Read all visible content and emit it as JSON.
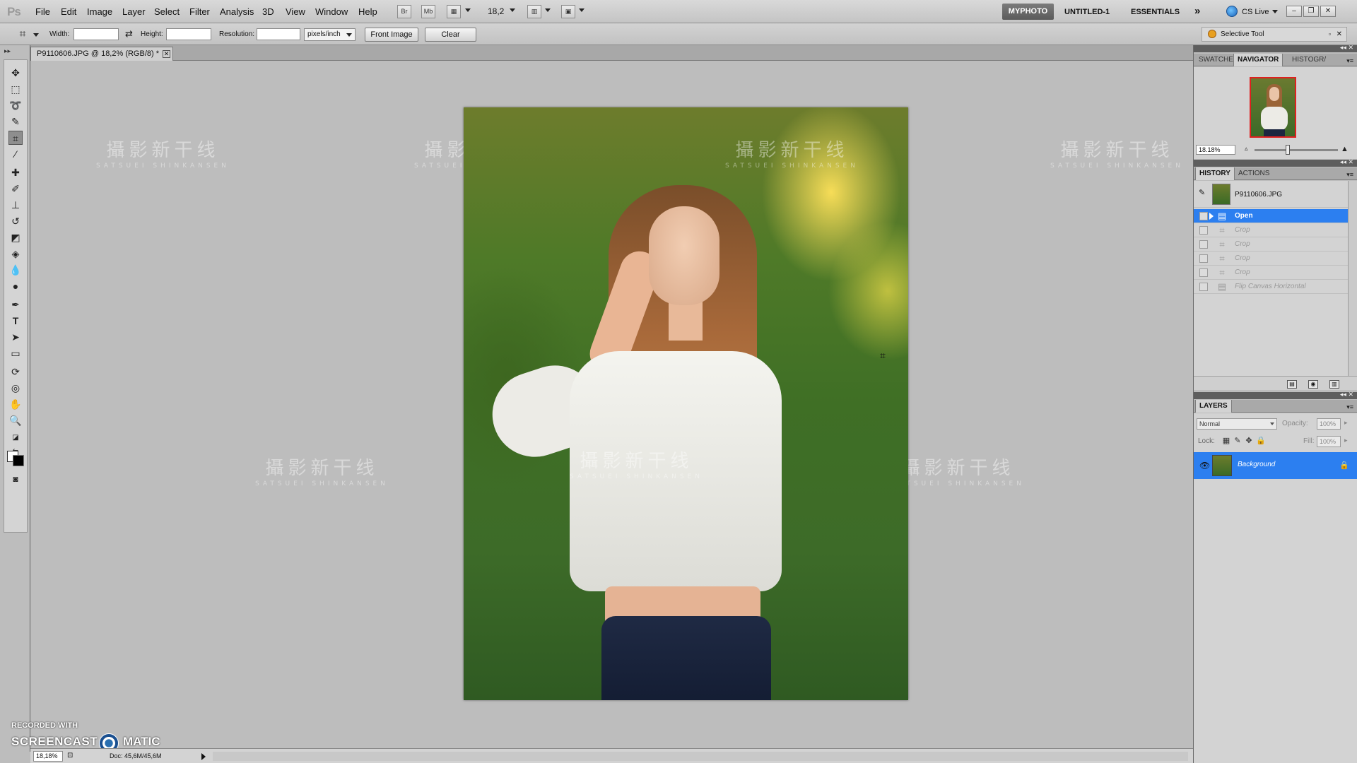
{
  "app": {
    "logo": "Ps",
    "menu": [
      "File",
      "Edit",
      "Image",
      "Layer",
      "Select",
      "Filter",
      "Analysis",
      "3D",
      "View",
      "Window",
      "Help"
    ],
    "bridge_button": "Br",
    "minibridge_button": "Mb",
    "zoom_level": "18,2",
    "workspaces": {
      "active": "MYPHOTO",
      "others": [
        "UNTITLED-1",
        "ESSENTIALS"
      ],
      "more": "»"
    },
    "cs_live": "CS Live",
    "window_controls": {
      "minimize": "–",
      "restore": "❐",
      "close": "✕"
    }
  },
  "options": {
    "width_label": "Width:",
    "width_value": "",
    "swap_icon": "⇄",
    "height_label": "Height:",
    "height_value": "",
    "resolution_label": "Resolution:",
    "resolution_value": "",
    "unit": "pixels/inch",
    "front_image": "Front Image",
    "clear": "Clear",
    "selective_tool": "Selective Tool"
  },
  "document": {
    "tab_title": "P9110606.JPG @ 18,2% (RGB/8) *",
    "zoom": "18,18%",
    "doc_size": "Doc: 45,6M/45,6M"
  },
  "watermark": {
    "title": "攝影新干线",
    "subtitle": "SATSUEI SHINKANSEN"
  },
  "recorder": {
    "recorded_with": "RECORDED WITH",
    "brand_left": "SCREENCAST",
    "brand_right": "MATIC"
  },
  "panels": {
    "top_tabs": [
      "SWATCHE",
      "NAVIGATOR",
      "HISTOGR/"
    ],
    "navigator_zoom": "18.18%",
    "history_tabs": [
      "HISTORY",
      "ACTIONS"
    ],
    "history_snapshot": "P9110606.JPG",
    "history": [
      {
        "label": "Open",
        "state": "selected",
        "icon": "open-doc-icon"
      },
      {
        "label": "Crop",
        "state": "future",
        "icon": "crop-icon"
      },
      {
        "label": "Crop",
        "state": "future",
        "icon": "crop-icon"
      },
      {
        "label": "Crop",
        "state": "future",
        "icon": "crop-icon"
      },
      {
        "label": "Crop",
        "state": "future",
        "icon": "crop-icon"
      },
      {
        "label": "Flip Canvas Horizontal",
        "state": "future",
        "icon": "flip-canvas-icon"
      }
    ],
    "layers_tab": "LAYERS",
    "blend_mode": "Normal",
    "opacity_label": "Opacity:",
    "opacity_value": "100%",
    "lock_label": "Lock:",
    "fill_label": "Fill:",
    "fill_value": "100%",
    "layer_name": "Background"
  },
  "colors": {
    "accent_selection": "#2c7ff0",
    "workspace_active": "#5a5a5a"
  }
}
